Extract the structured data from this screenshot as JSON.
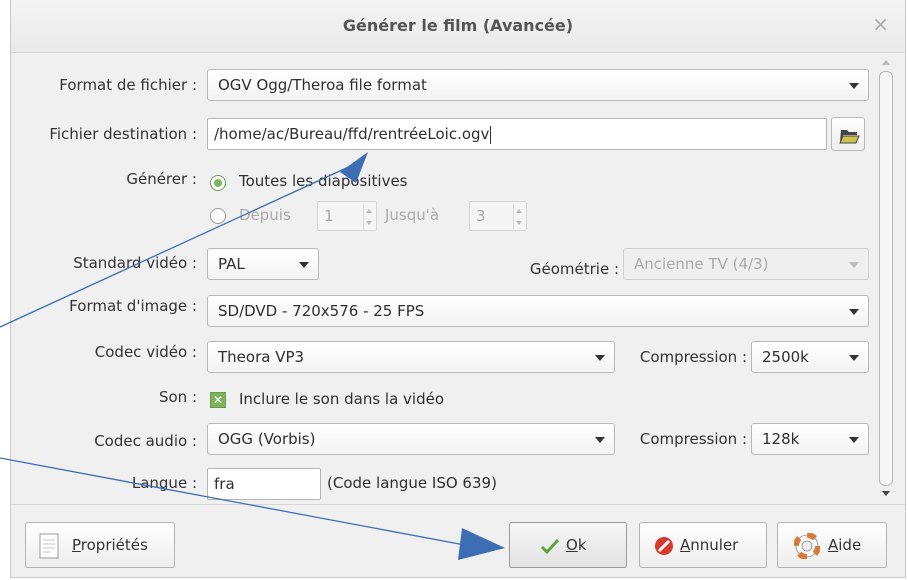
{
  "dialog": {
    "title": "Générer le film (Avancée)",
    "close_glyph": "×"
  },
  "form": {
    "format_label": "Format de fichier :",
    "format_value": "OGV Ogg/Theroa file format",
    "destination_label": "Fichier destination :",
    "destination_value": "/home/ac/Bureau/ffd/rentréeLoic.ogv",
    "generate_label": "Générer :",
    "radio_all_label": "Toutes les diapositives",
    "radio_all_selected": true,
    "radio_from_label": "Depuis",
    "from_value": "1",
    "until_label": "Jusqu'à",
    "until_value": "3",
    "video_standard_label": "Standard vidéo :",
    "video_standard_value": "PAL",
    "geometry_label": "Géométrie :",
    "geometry_value": "Ancienne TV (4/3)",
    "image_format_label": "Format d'image :",
    "image_format_value": "SD/DVD - 720x576 - 25 FPS",
    "video_codec_label": "Codec vidéo :",
    "video_codec_value": "Theora VP3",
    "video_compression_label": "Compression :",
    "video_compression_value": "2500k",
    "sound_label": "Son :",
    "sound_checkbox_label": "Inclure le son dans la vidéo",
    "sound_checked": true,
    "audio_codec_label": "Codec audio :",
    "audio_codec_value": "OGG (Vorbis)",
    "audio_compression_label": "Compression :",
    "audio_compression_value": "128k",
    "language_label": "Langue :",
    "language_value": "fra",
    "language_hint": "(Code langue ISO 639)"
  },
  "buttons": {
    "properties_label_u": "P",
    "properties_label_rest": "ropriétés",
    "ok_label_u": "O",
    "ok_label_rest": "k",
    "cancel_label_u": "A",
    "cancel_label_rest": "nnuler",
    "help_label_u": "A",
    "help_label_rest": "ide"
  },
  "icons": {
    "folder": "folder-open-icon",
    "properties": "document-icon",
    "ok": "checkmark-icon",
    "cancel": "stop-icon",
    "help": "lifebuoy-icon"
  },
  "colors": {
    "accent_green": "#7db45e",
    "annotation_blue": "#3d6eb3",
    "cancel_red": "#d63a2f",
    "help_orange": "#e8792b"
  }
}
